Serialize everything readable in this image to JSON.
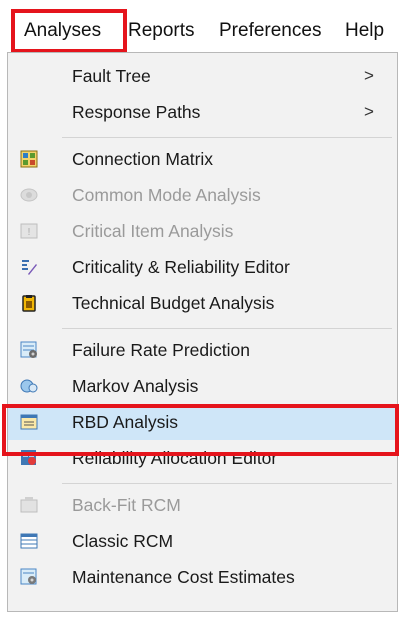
{
  "menubar": {
    "items": [
      {
        "label": "Analyses"
      },
      {
        "label": "Reports"
      },
      {
        "label": "Preferences"
      },
      {
        "label": "Help"
      }
    ]
  },
  "menu": {
    "items": [
      {
        "label": "Fault Tree",
        "submenu": true,
        "enabled": true
      },
      {
        "label": "Response Paths",
        "submenu": true,
        "enabled": true
      },
      {
        "label": "Connection Matrix",
        "icon": "connection-matrix-icon",
        "enabled": true
      },
      {
        "label": "Common Mode Analysis",
        "icon": "common-mode-icon",
        "enabled": false
      },
      {
        "label": "Critical Item Analysis",
        "icon": "critical-item-icon",
        "enabled": false
      },
      {
        "label": "Criticality & Reliability Editor",
        "icon": "criticality-editor-icon",
        "enabled": true
      },
      {
        "label": "Technical Budget Analysis",
        "icon": "technical-budget-icon",
        "enabled": true
      },
      {
        "label": "Failure Rate Prediction",
        "icon": "failure-rate-icon",
        "enabled": true
      },
      {
        "label": "Markov Analysis",
        "icon": "markov-icon",
        "enabled": true
      },
      {
        "label": "RBD Analysis",
        "icon": "rbd-icon",
        "enabled": true,
        "selected": true
      },
      {
        "label": "Reliability Allocation Editor",
        "icon": "reliability-allocation-icon",
        "enabled": true
      },
      {
        "label": "Back-Fit RCM",
        "icon": "back-fit-rcm-icon",
        "enabled": false
      },
      {
        "label": "Classic RCM",
        "icon": "classic-rcm-icon",
        "enabled": true
      },
      {
        "label": "Maintenance Cost Estimates",
        "icon": "maintenance-cost-icon",
        "enabled": true
      }
    ],
    "submenu_arrow": ">"
  },
  "colors": {
    "highlight_box": "#e5141c",
    "selected_row": "#cfe6f8",
    "menu_background": "#f2f2f2",
    "disabled_text": "#9a9a9a"
  }
}
